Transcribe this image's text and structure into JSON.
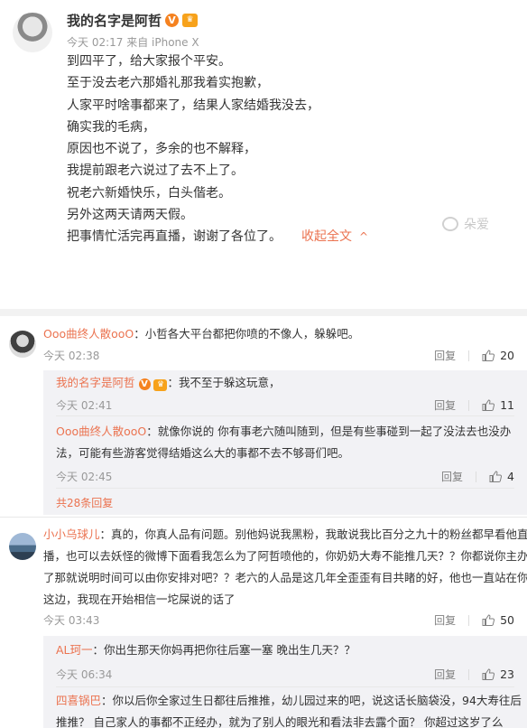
{
  "post": {
    "user_name": "我的名字是阿哲",
    "verified_badge": "V",
    "meta": "今天 02:17 来自 iPhone X",
    "lines": [
      "到四平了，给大家报个平安。",
      "至于没去老六那婚礼那我着实抱歉，",
      "人家平时啥事都来了，结果人家结婚我没去，",
      "确实我的毛病，",
      "原因也不说了，多余的也不解释，",
      "我提前跟老六说过了去不上了。",
      "祝老六新婚快乐，白头偕老。",
      "另外这两天请两天假。",
      "把事情忙活完再直播，谢谢了各位了。"
    ],
    "fold_label": "收起全文",
    "fold_arrow": "^",
    "watermark_text": "朵爱"
  },
  "comments": [
    {
      "name": "Ooo曲终人散ooO",
      "text": "：小哲各大平台都把你喷的不像人，躲躲吧。",
      "time": "今天 02:38",
      "reply_label": "回复",
      "likes": "20",
      "replies": [
        {
          "name": "我的名字是阿哲",
          "badge": "V",
          "text": "：我不至于躲这玩意，",
          "time": "今天 02:41",
          "reply_label": "回复",
          "likes": "11"
        },
        {
          "name": "Ooo曲终人散ooO",
          "text_lines": [
            "：就像你说的 你有事老六随叫随到，但是有些事碰到一起了没法去也没办",
            "法，可能有些游客觉得结婚这么大的事都不去不够哥们吧。"
          ],
          "time": "今天 02:45",
          "reply_label": "回复",
          "likes": "4"
        }
      ],
      "more_label": "共28条回复"
    },
    {
      "name": "小小乌球儿",
      "text_lines": [
        "：真的，你真人品有问题。别他妈说我黑粉，我敢说我比百分之九十的粉丝都早看他直",
        "播，也可以去妖怪的微博下面看我怎么为了阿哲喷他的，你奶奶大寿不能推几天？？你都说你主办",
        "了那就说明时间可以由你安排对吧？？老六的人品是这几年全歪歪有目共睹的好，他也一直站在你",
        "这边，我现在开始相信一坨屎说的话了"
      ],
      "time": "今天 03:43",
      "reply_label": "回复",
      "likes": "50",
      "replies": [
        {
          "name": "AL珂一",
          "text": "：你出生那天你妈再把你往后塞一塞 晚出生几天？？",
          "time": "今天 06:34",
          "reply_label": "回复",
          "likes": "23"
        },
        {
          "name": "四喜锅巴",
          "text_lines": [
            "：你以后你全家过生日都往后推推，幼儿园过来的吧，说这话长脑袋没，94大寿往后",
            "推推？ 自己家人的事都不正经办，就为了别人的眼光和看法非去露个面？ 你超过这岁了么"
          ]
        }
      ]
    }
  ],
  "colors": {
    "accent": "#eb7350",
    "text": "#333333",
    "meta": "#999999",
    "subbox_bg": "#f2f2f5",
    "separator": "#f2f2f2"
  },
  "icons": [
    "like-thumb-icon",
    "crown-badge-icon",
    "verified-icon"
  ]
}
